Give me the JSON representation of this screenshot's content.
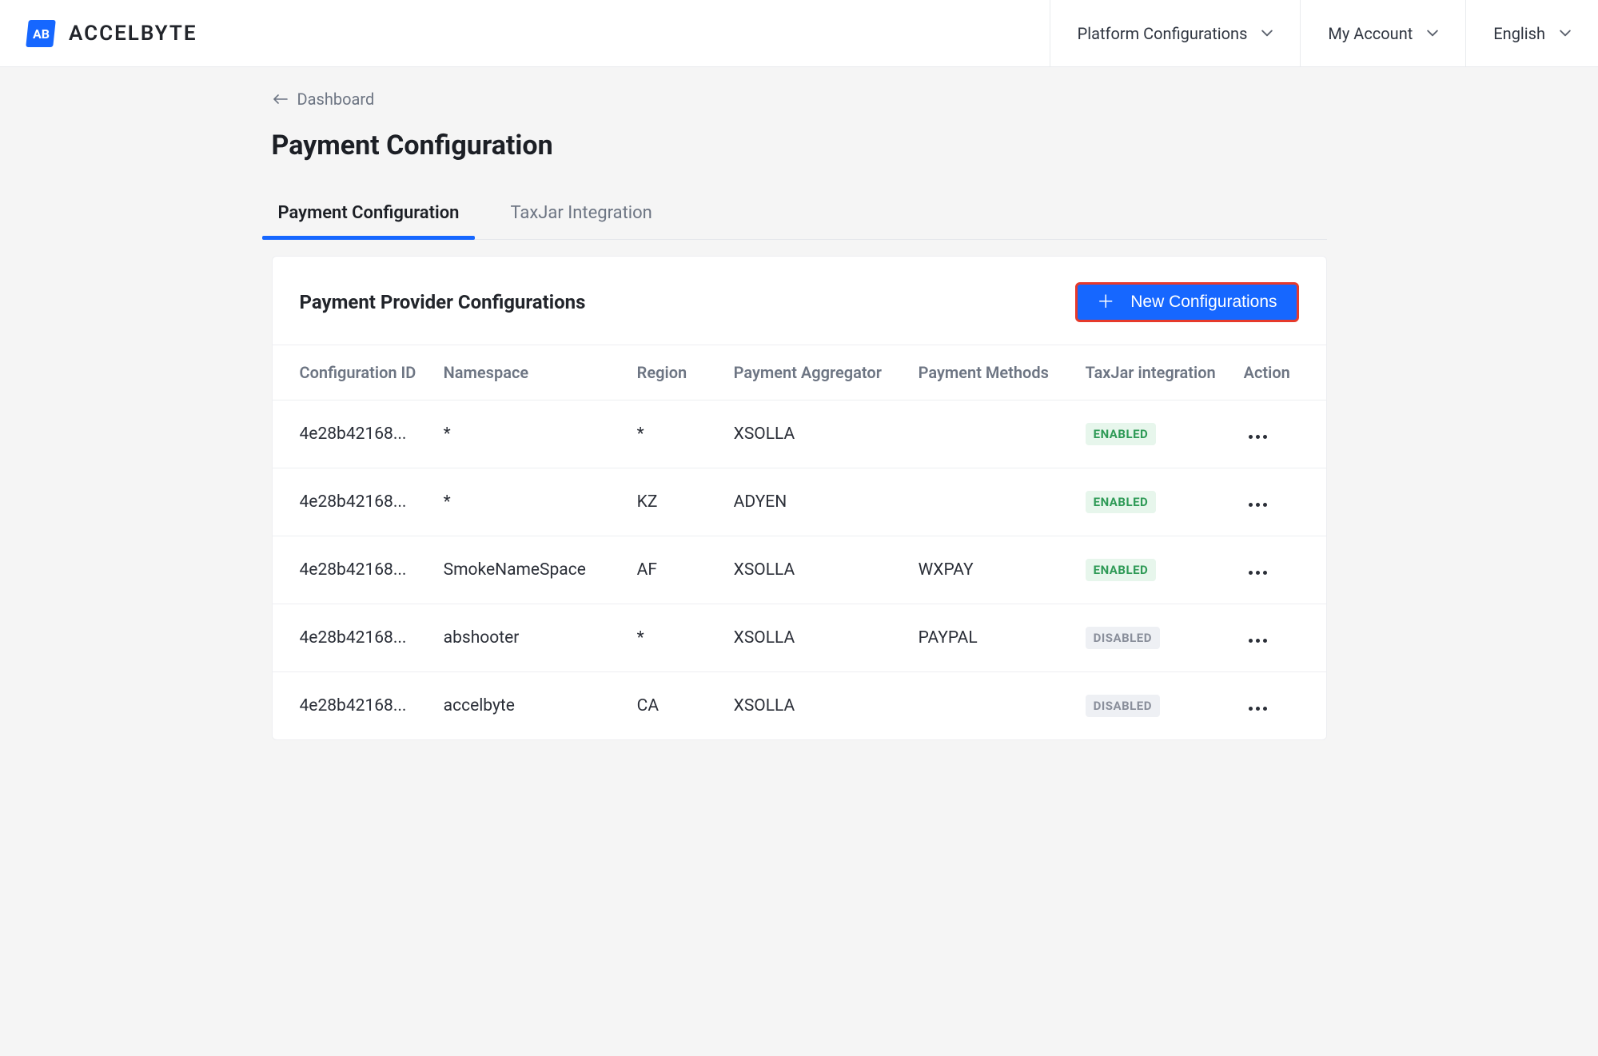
{
  "brand": {
    "logo_text": "AB",
    "name": "ACCELBYTE"
  },
  "topmenu": {
    "platform": "Platform Configurations",
    "account": "My Account",
    "language": "English"
  },
  "breadcrumb": {
    "label": "Dashboard"
  },
  "page_title": "Payment Configuration",
  "tabs": [
    {
      "label": "Payment Configuration",
      "active": true
    },
    {
      "label": "TaxJar Integration",
      "active": false
    }
  ],
  "card": {
    "title": "Payment Provider Configurations",
    "new_button": "New Configurations"
  },
  "table": {
    "headers": {
      "config_id": "Configuration ID",
      "namespace": "Namespace",
      "region": "Region",
      "aggregator": "Payment Aggregator",
      "methods": "Payment Methods",
      "taxjar": "TaxJar integration",
      "action": "Action"
    },
    "rows": [
      {
        "config_id": "4e28b42168...",
        "namespace": "*",
        "region": "*",
        "aggregator": "XSOLLA",
        "methods": "",
        "taxjar": "ENABLED"
      },
      {
        "config_id": "4e28b42168...",
        "namespace": "*",
        "region": "KZ",
        "aggregator": "ADYEN",
        "methods": "",
        "taxjar": "ENABLED"
      },
      {
        "config_id": "4e28b42168...",
        "namespace": "SmokeNameSpace",
        "region": "AF",
        "aggregator": "XSOLLA",
        "methods": "WXPAY",
        "taxjar": "ENABLED"
      },
      {
        "config_id": "4e28b42168...",
        "namespace": "abshooter",
        "region": "*",
        "aggregator": "XSOLLA",
        "methods": "PAYPAL",
        "taxjar": "DISABLED"
      },
      {
        "config_id": "4e28b42168...",
        "namespace": "accelbyte",
        "region": "CA",
        "aggregator": "XSOLLA",
        "methods": "",
        "taxjar": "DISABLED"
      }
    ]
  }
}
